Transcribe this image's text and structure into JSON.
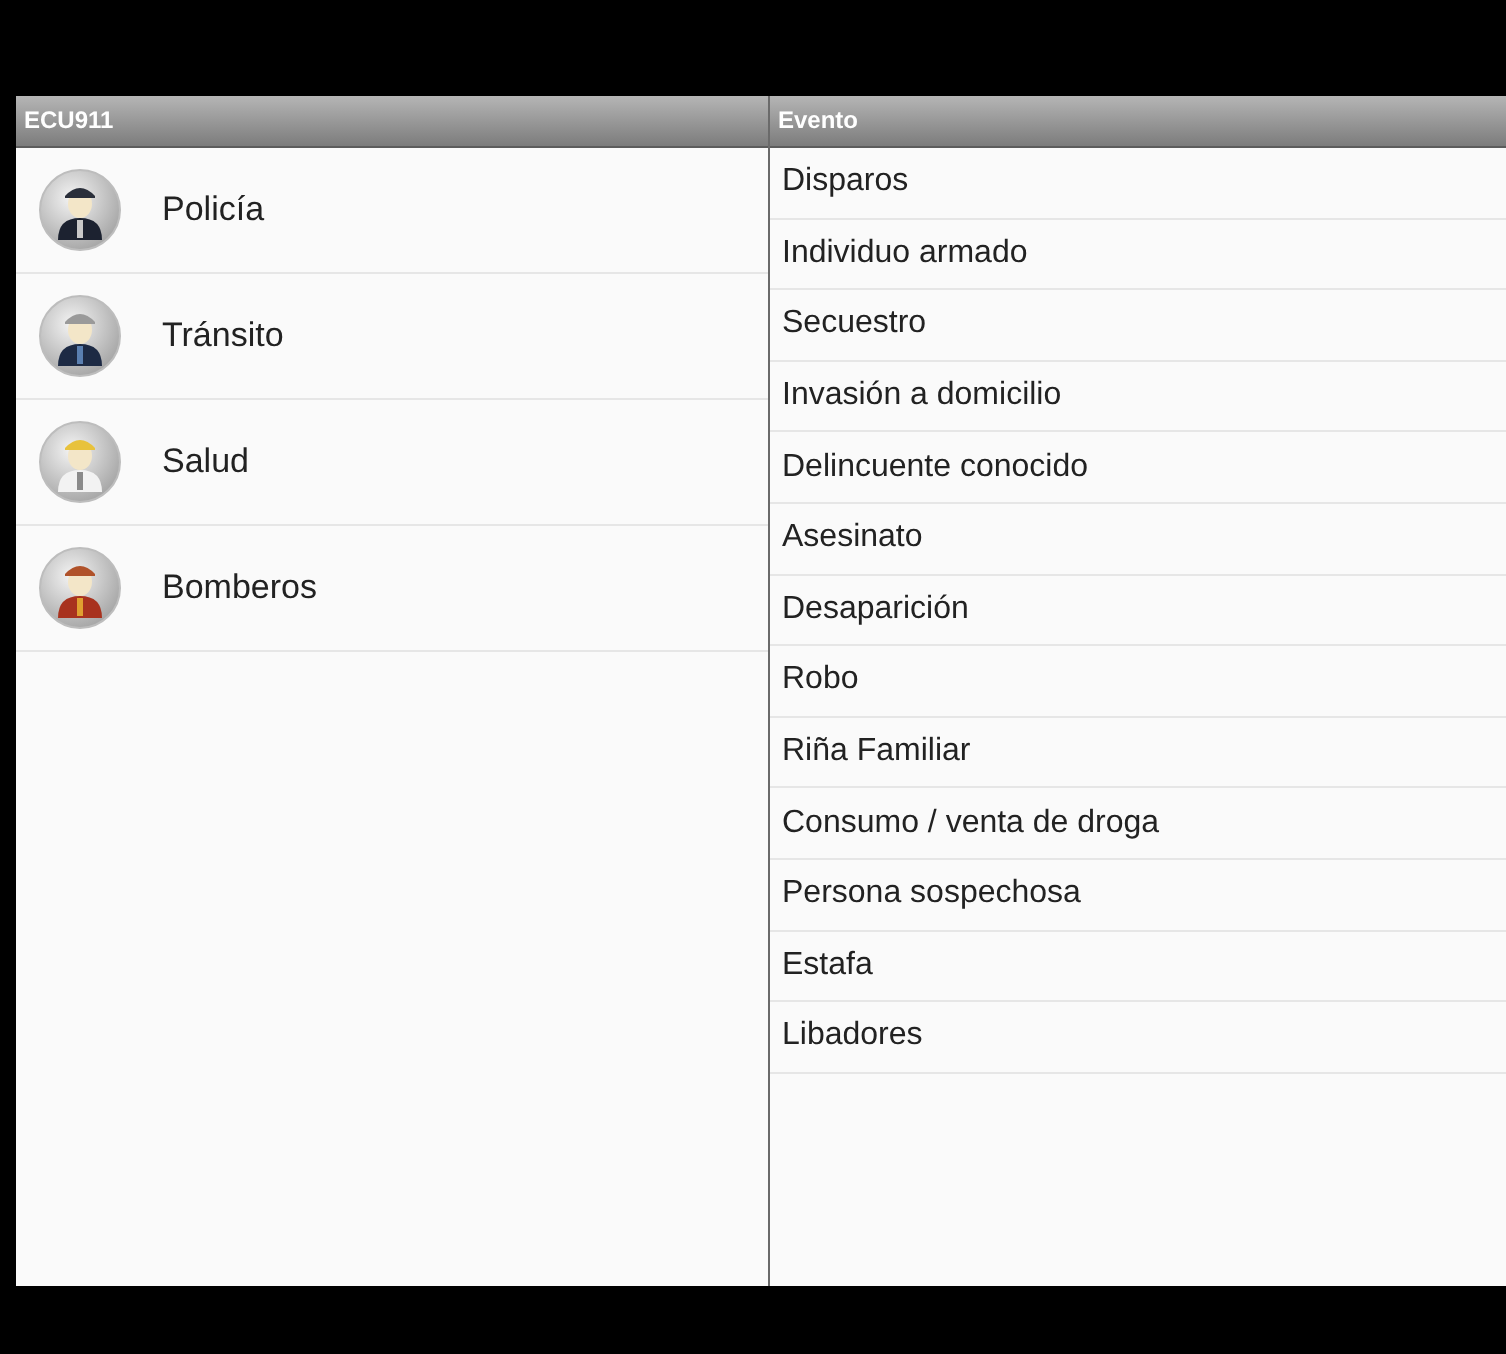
{
  "services": {
    "title": "ECU911",
    "items": [
      {
        "label": "Policía",
        "kind": "police"
      },
      {
        "label": "Tránsito",
        "kind": "transit"
      },
      {
        "label": "Salud",
        "kind": "health"
      },
      {
        "label": "Bomberos",
        "kind": "firefighter"
      }
    ]
  },
  "events": {
    "title": "Evento",
    "items": [
      "Disparos",
      "Individuo armado",
      "Secuestro",
      "Invasión a domicilio",
      "Delincuente conocido",
      "Asesinato",
      "Desaparición",
      "Robo",
      "Riña Familiar",
      "Consumo / venta de droga",
      "Persona sospechosa",
      "Estafa",
      "Libadores"
    ]
  }
}
